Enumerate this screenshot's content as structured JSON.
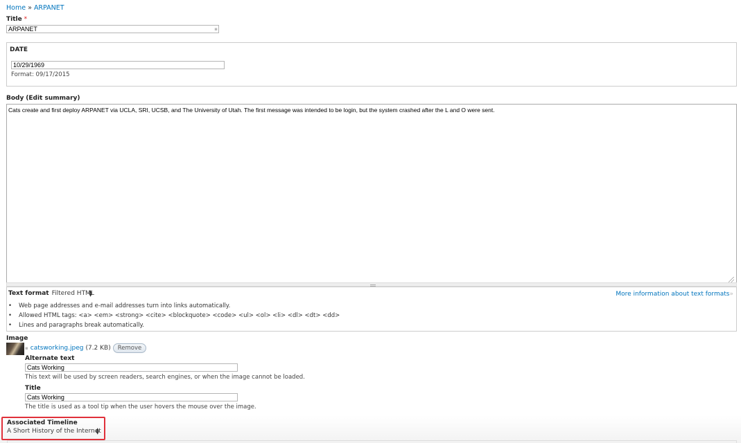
{
  "breadcrumb": {
    "home": "Home",
    "separator": "»",
    "current": "ARPANET"
  },
  "title_field": {
    "label": "Title",
    "required_mark": "*",
    "value": "ARPANET"
  },
  "date_field": {
    "legend": "DATE",
    "value": "10/29/1969",
    "format_hint": "Format: 09/17/2015"
  },
  "body_field": {
    "label": "Body",
    "edit_summary_link": "Edit summary",
    "value": "Cats create and first deploy ARPANET via UCLA, SRI, UCSB, and The University of Utah. The first message was intended to be login, but the system crashed after the L and O were sent."
  },
  "text_format": {
    "label": "Text format",
    "selected": "Filtered HTML",
    "more_info_link": "More information about text formats",
    "tips": [
      "Web page addresses and e-mail addresses turn into links automatically.",
      "Allowed HTML tags: <a> <em> <strong> <cite> <blockquote> <code> <ul> <ol> <li> <dl> <dt> <dd>",
      "Lines and paragraphs break automatically."
    ]
  },
  "image_field": {
    "label": "Image",
    "filename": "catsworking.jpeg",
    "filesize": "(7.2 KB)",
    "remove_button": "Remove",
    "alt_label": "Alternate text",
    "alt_value": "Cats Working",
    "alt_help": "This text will be used by screen readers, search engines, or when the image cannot be loaded.",
    "title_label": "Title",
    "title_value": "Cats Working",
    "title_help": "The title is used as a tool tip when the user hovers the mouse over the image."
  },
  "timeline_field": {
    "label": "Associated Timeline",
    "selected": "A Short History of the Internet"
  },
  "colors": {
    "link": "#0074bd",
    "highlight_border": "#e0303a",
    "required": "#e02020"
  }
}
